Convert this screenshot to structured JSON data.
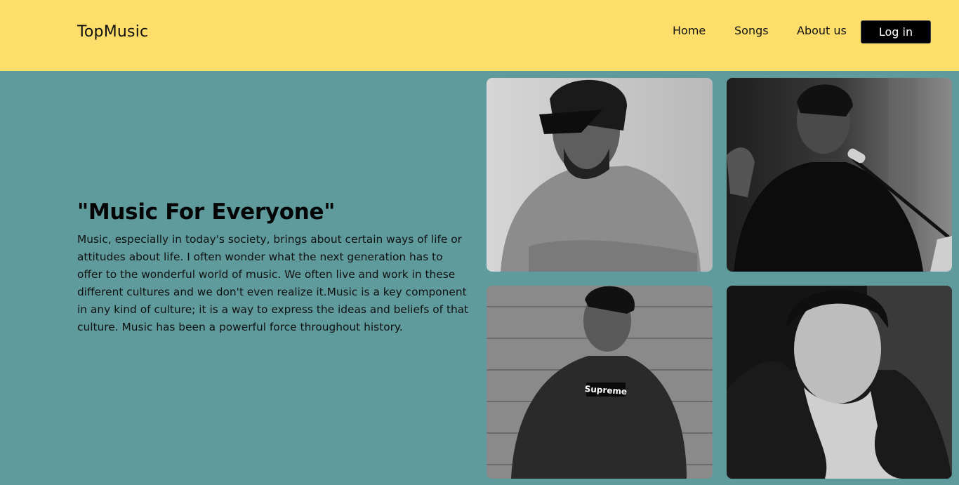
{
  "header": {
    "logo": "TopMusic",
    "nav": {
      "home": "Home",
      "songs": "Songs",
      "about": "About us",
      "login": "Log in"
    }
  },
  "hero": {
    "title": "\"Music For Everyone\"",
    "body": "Music, especially in today's society, brings about certain ways of life or attitudes about life. I often wonder what the next generation has to offer to the wonderful world of music. We often live and work in these different cultures and we don't even realize it.Music is a key component in any kind of culture; it is a way to express the ideas and beliefs of that culture. Music has been a powerful force throughout history."
  },
  "gallery": {
    "shirt_logo": "Supreme"
  },
  "colors": {
    "header_bg": "#fede6b",
    "page_bg": "#5f9b9c",
    "button_bg": "#000000"
  }
}
